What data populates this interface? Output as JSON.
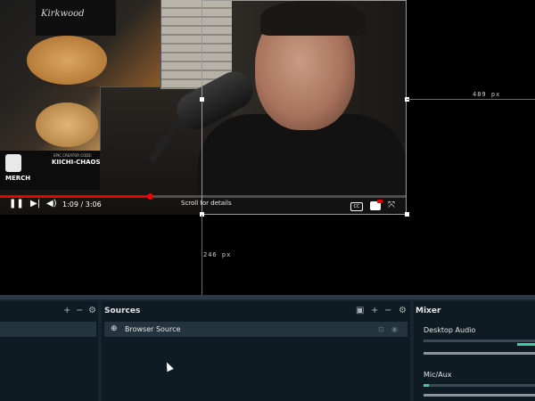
{
  "preview": {
    "video": {
      "shirt_text": "Kirkwood",
      "promo_code_label": "EPIC CREATOR CODE:",
      "promo_code": "KIICHI-CHAOS",
      "merch_label": "MERCH",
      "time": "1:09 / 3:06",
      "tooltip": "Scroll for details",
      "cc_label": "CC",
      "progress": 0.37
    },
    "guides": {
      "horizontal_label": "489 px",
      "vertical_label": "246 px"
    }
  },
  "dock": {
    "sources": {
      "title": "Sources",
      "items": [
        {
          "label": "Browser Source"
        }
      ]
    },
    "mixer": {
      "title": "Mixer",
      "channels": [
        {
          "label": "Desktop Audio",
          "level": 0.0
        },
        {
          "label": "Mic/Aux",
          "level": 0.05
        }
      ]
    },
    "icons": {
      "add": "+",
      "remove": "−",
      "settings": "⚙",
      "folder": "▣"
    }
  },
  "colors": {
    "accent": "#3cd0a0",
    "dock_bg": "#17252e",
    "panel_bg": "#0f1b22",
    "row_bg": "#23343e",
    "progress": "#e00000"
  }
}
